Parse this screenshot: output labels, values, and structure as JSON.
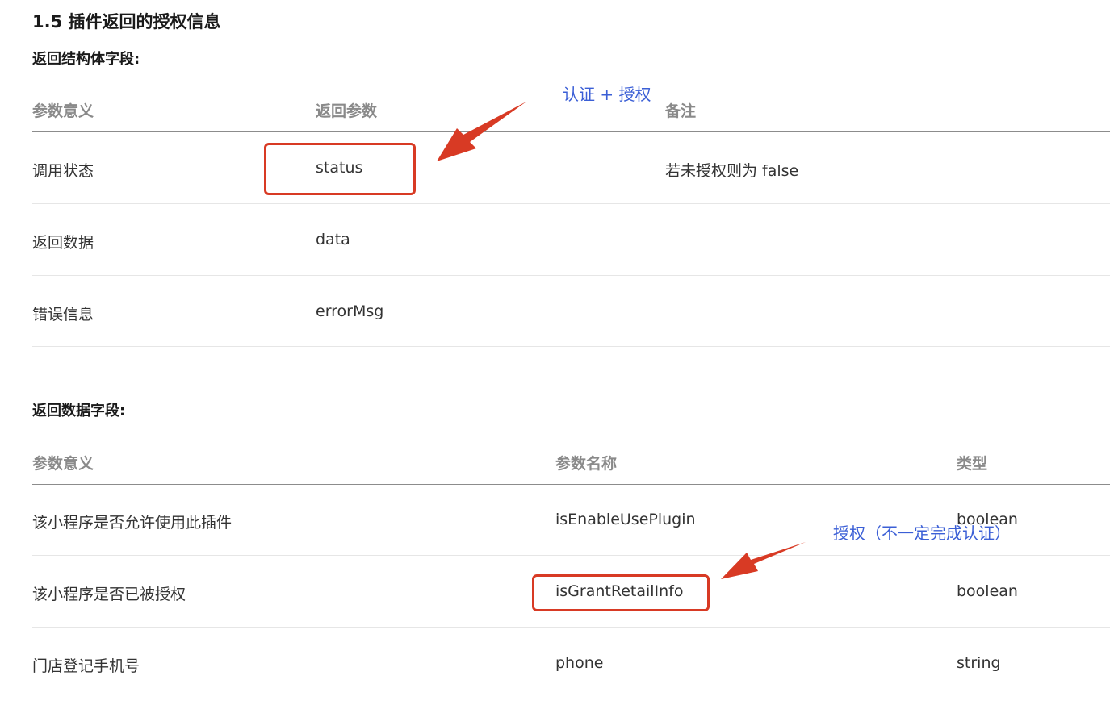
{
  "section": {
    "title": "1.5 插件返回的授权信息"
  },
  "return_struct": {
    "heading": "返回结构体字段:",
    "columns": [
      "参数意义",
      "返回参数",
      "备注"
    ],
    "rows": [
      {
        "meaning": "调用状态",
        "param": "status",
        "note": "若未授权则为 false"
      },
      {
        "meaning": "返回数据",
        "param": "data",
        "note": ""
      },
      {
        "meaning": "错误信息",
        "param": "errorMsg",
        "note": ""
      }
    ]
  },
  "return_data": {
    "heading": "返回数据字段:",
    "columns": [
      "参数意义",
      "参数名称",
      "类型"
    ],
    "rows": [
      {
        "meaning": "该小程序是否允许使用此插件",
        "param": "isEnableUsePlugin",
        "type": "boolean"
      },
      {
        "meaning": "该小程序是否已被授权",
        "param": "isGrantRetailInfo",
        "type": "boolean"
      },
      {
        "meaning": "门店登记手机号",
        "param": "phone",
        "type": "string"
      }
    ]
  },
  "annotations": {
    "status_note": "认证 + 授权",
    "grant_note": "授权（不一定完成认证）",
    "color": "#d83a24",
    "text_color": "#3b5fd6"
  }
}
